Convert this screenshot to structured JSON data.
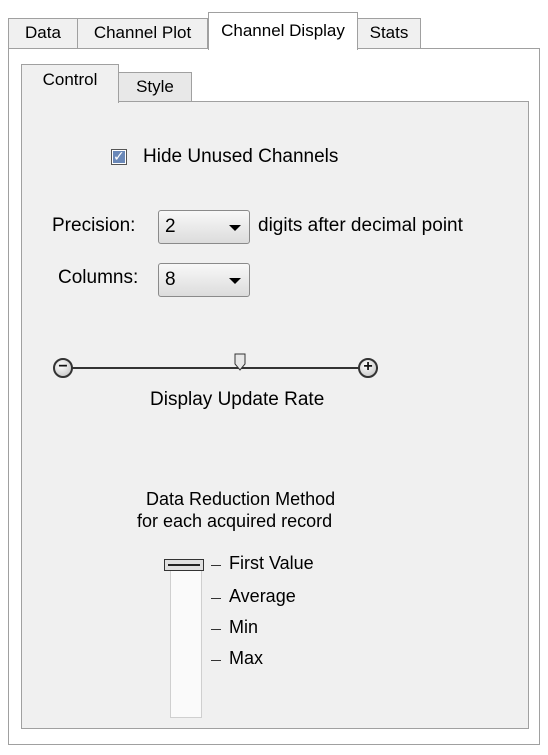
{
  "outer_tabs": [
    "Data",
    "Channel Plot",
    "Channel Display",
    "Stats"
  ],
  "outer_active": "Channel Display",
  "inner_tabs": [
    "Control",
    "Style"
  ],
  "inner_active": "Control",
  "hide_unused": {
    "label": "Hide Unused Channels",
    "checked": true
  },
  "precision": {
    "label": "Precision:",
    "value": "2",
    "suffix": "digits after decimal point"
  },
  "columns": {
    "label": "Columns:",
    "value": "8"
  },
  "update_rate": {
    "label": "Display Update Rate",
    "minus_icon": "minus-circle-icon",
    "plus_icon": "plus-circle-icon"
  },
  "reduction": {
    "title_line1": "Data Reduction Method",
    "title_line2": "for each acquired record",
    "options": [
      "First Value",
      "Average",
      "Min",
      "Max"
    ],
    "selected": "First Value"
  }
}
